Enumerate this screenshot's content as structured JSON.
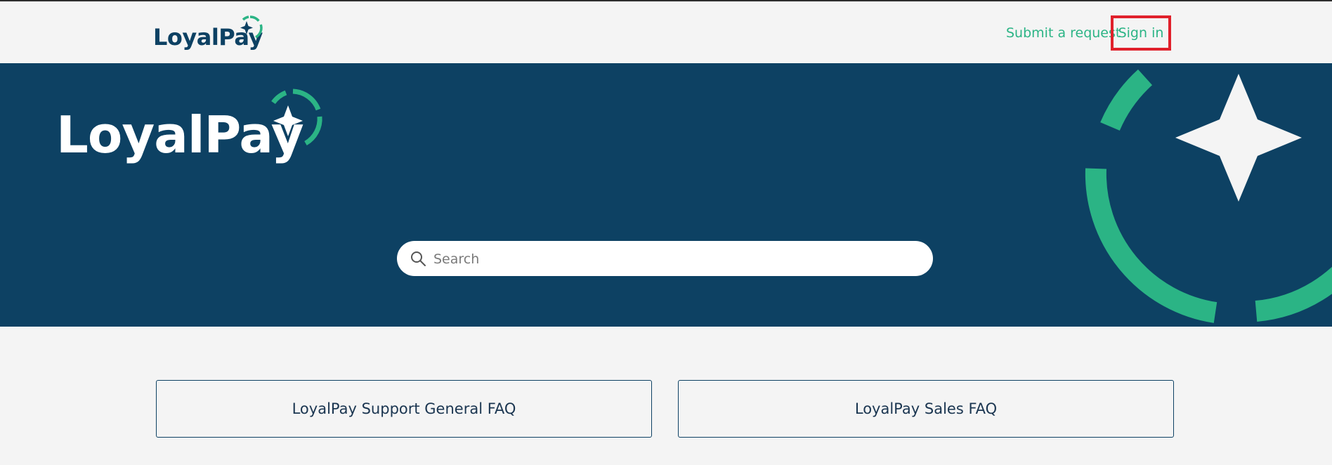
{
  "header": {
    "logo_text": "LoyalPay",
    "nav": {
      "submit_request": "Submit a request",
      "sign_in": "Sign in"
    }
  },
  "hero": {
    "logo_text": "LoyalPay",
    "search": {
      "placeholder": "Search",
      "value": ""
    }
  },
  "categories": [
    {
      "label": "LoyalPay Support General FAQ"
    },
    {
      "label": "LoyalPay Sales FAQ"
    }
  ],
  "colors": {
    "brand_navy": "#0d4163",
    "brand_green": "#2bb485",
    "background": "#f4f4f4",
    "highlight_red": "#e0202b"
  },
  "icons": {
    "search": "search-icon",
    "logo_mark": "sparkle-ring-icon"
  }
}
